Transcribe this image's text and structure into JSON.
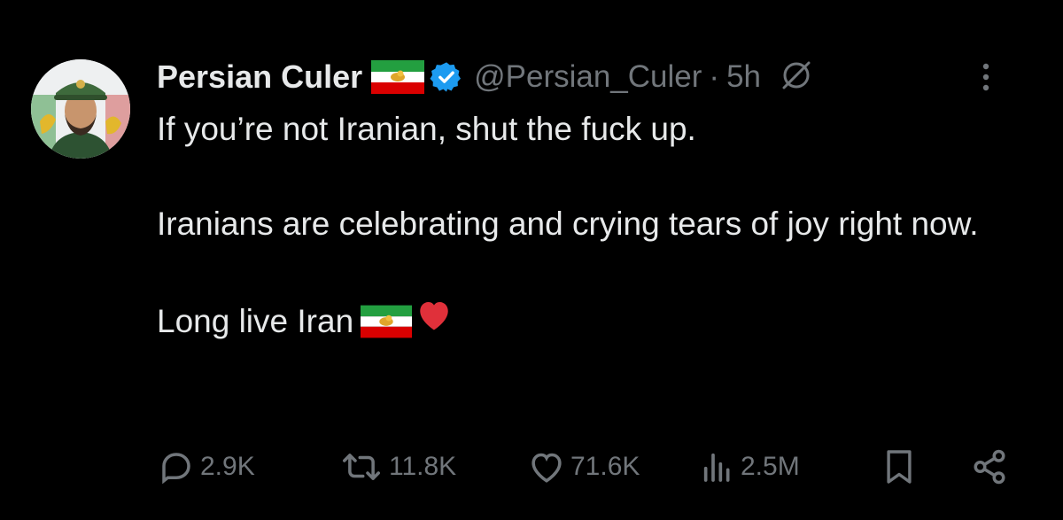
{
  "tweet": {
    "author_name": "Persian Culer",
    "handle": "@Persian_Culer",
    "separator": "·",
    "time": "5h",
    "paragraphs": [
      "If you’re not Iranian, shut the fuck up.",
      "Iranians are celebrating and crying tears of joy right now.",
      "Long live Iran"
    ],
    "icons": {
      "flag": "iran-lion-sun-flag-icon",
      "verified": "verified-badge-icon",
      "grok": "grok-icon",
      "more": "more-options-icon",
      "heart": "red-heart-emoji"
    }
  },
  "actions": {
    "replies": "2.9K",
    "reposts": "11.8K",
    "likes": "71.6K",
    "views": "2.5M"
  },
  "colors": {
    "background": "#000000",
    "text": "#e7e9ea",
    "muted": "#71767b",
    "verified": "#1d9bf0"
  }
}
